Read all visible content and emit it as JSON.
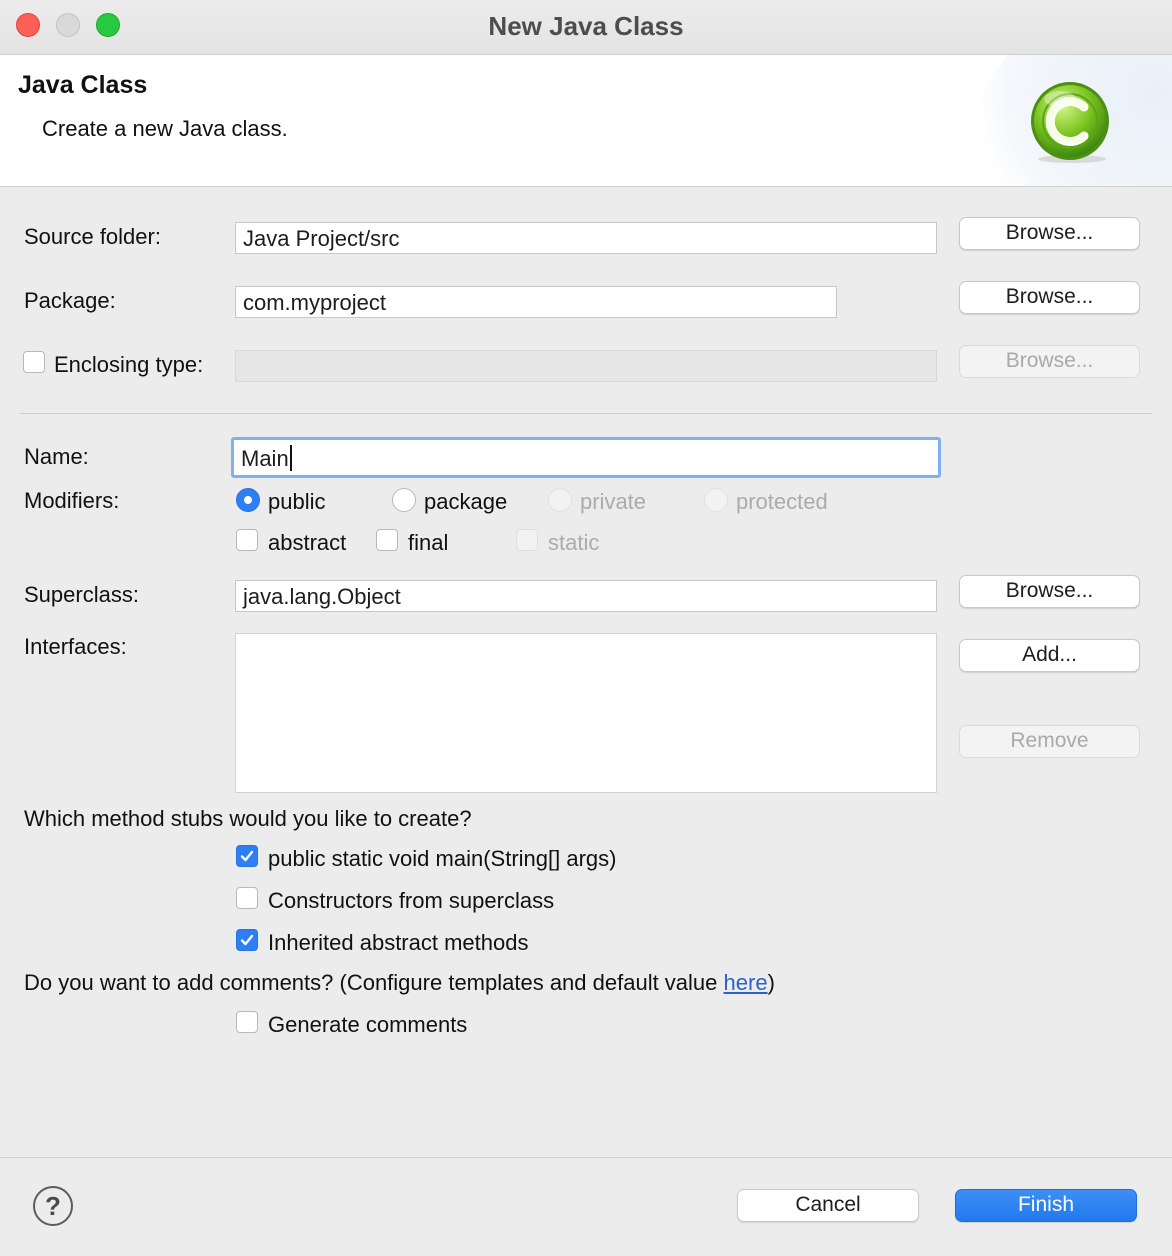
{
  "window": {
    "title": "New Java Class"
  },
  "header": {
    "title": "Java Class",
    "description": "Create a new Java class."
  },
  "form": {
    "source_folder": {
      "label": "Source folder:",
      "value": "Java Project/src",
      "button": "Browse..."
    },
    "package": {
      "label": "Package:",
      "value": "com.myproject",
      "button": "Browse..."
    },
    "enclosing_type": {
      "label": "Enclosing type:",
      "value": "",
      "checked": false,
      "button": "Browse..."
    },
    "name": {
      "label": "Name:",
      "value": "Main"
    },
    "modifiers": {
      "label": "Modifiers:",
      "access": [
        {
          "label": "public",
          "selected": true,
          "enabled": true
        },
        {
          "label": "package",
          "selected": false,
          "enabled": true
        },
        {
          "label": "private",
          "selected": false,
          "enabled": false
        },
        {
          "label": "protected",
          "selected": false,
          "enabled": false
        }
      ],
      "flags": [
        {
          "label": "abstract",
          "checked": false,
          "enabled": true
        },
        {
          "label": "final",
          "checked": false,
          "enabled": true
        },
        {
          "label": "static",
          "checked": false,
          "enabled": false
        }
      ]
    },
    "superclass": {
      "label": "Superclass:",
      "value": "java.lang.Object",
      "button": "Browse..."
    },
    "interfaces": {
      "label": "Interfaces:",
      "items": [],
      "add_button": "Add...",
      "remove_button": "Remove"
    },
    "stubs": {
      "question": "Which method stubs would you like to create?",
      "options": [
        {
          "label": "public static void main(String[] args)",
          "checked": true
        },
        {
          "label": "Constructors from superclass",
          "checked": false
        },
        {
          "label": "Inherited abstract methods",
          "checked": true
        }
      ]
    },
    "comments": {
      "question_prefix": "Do you want to add comments? (Configure templates and default value ",
      "link": "here",
      "question_suffix": ")",
      "option": {
        "label": "Generate comments",
        "checked": false
      }
    }
  },
  "footer": {
    "help": "?",
    "cancel": "Cancel",
    "finish": "Finish"
  },
  "colors": {
    "accent": "#2d7ff5",
    "finish_button": "#2279ee",
    "link": "#2a62c9"
  }
}
